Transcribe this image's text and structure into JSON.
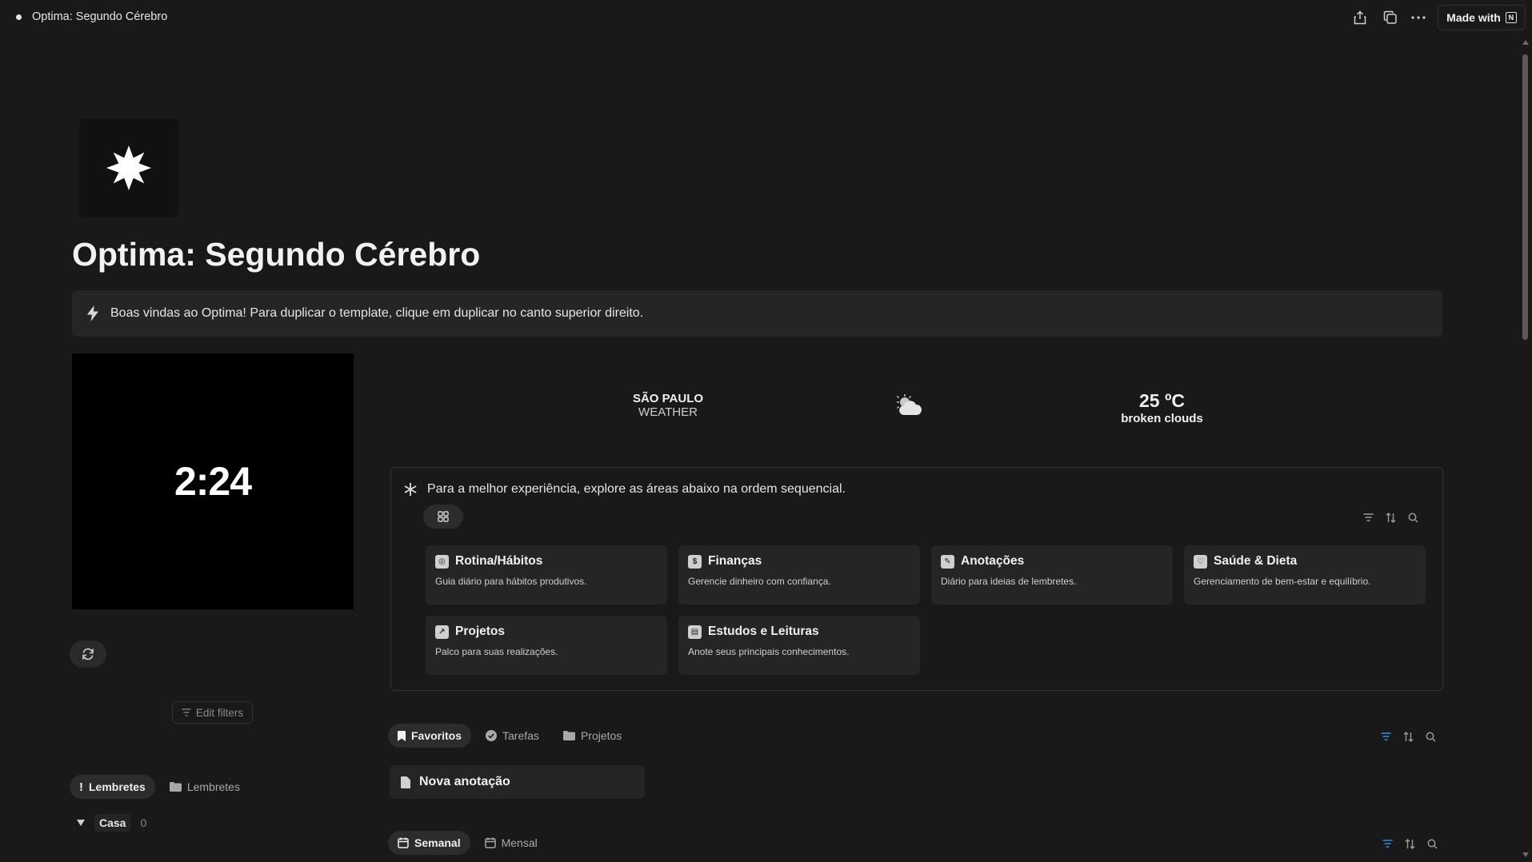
{
  "window": {
    "title": "Optima: Segundo Cérebro"
  },
  "toolbar": {
    "share_icon": "share-icon",
    "duplicate_icon": "duplicate-icon",
    "more_icon": "more-icon",
    "made_with_label": "Made with"
  },
  "page": {
    "icon": "starburst-icon",
    "title": "Optima: Segundo Cérebro",
    "callout": "Boas vindas ao Optima! Para duplicar o template, clique em duplicar no canto superior direito."
  },
  "clock": {
    "time": "2:24"
  },
  "edit_filters_label": "Edit filters",
  "weather": {
    "city": "SÃO PAULO",
    "subtitle": "WEATHER",
    "temperature": "25 ºC",
    "condition": "broken clouds"
  },
  "areas": {
    "header": "Para a melhor experiência, explore as áreas abaixo na ordem sequencial.",
    "cards": [
      {
        "title": "Rotina/Hábitos",
        "desc": "Guia diário para hábitos produtivos."
      },
      {
        "title": "Finanças",
        "desc": "Gerencie dinheiro com confiança."
      },
      {
        "title": "Anotações",
        "desc": "Diário para ideias de lembretes."
      },
      {
        "title": "Saúde & Dieta",
        "desc": "Gerenciamento de bem-estar e equilíbrio."
      },
      {
        "title": "Projetos",
        "desc": "Palco para suas realizações."
      },
      {
        "title": "Estudos e Leituras",
        "desc": "Anote seus principais conhecimentos."
      }
    ]
  },
  "reminders": {
    "tabs": [
      {
        "label": "Lembretes",
        "active": true
      },
      {
        "label": "Lembretes",
        "active": false
      }
    ],
    "group": {
      "label": "Casa",
      "count": "0"
    }
  },
  "favorites": {
    "tabs": [
      {
        "label": "Favoritos",
        "active": true
      },
      {
        "label": "Tarefas",
        "active": false
      },
      {
        "label": "Projetos",
        "active": false
      }
    ],
    "item": "Nova anotação"
  },
  "calendar": {
    "tabs": [
      {
        "label": "Semanal",
        "active": true
      },
      {
        "label": "Mensal",
        "active": false
      }
    ]
  },
  "colors": {
    "background": "#191919",
    "card": "#252525",
    "accent_blue": "#2e8fe0"
  }
}
